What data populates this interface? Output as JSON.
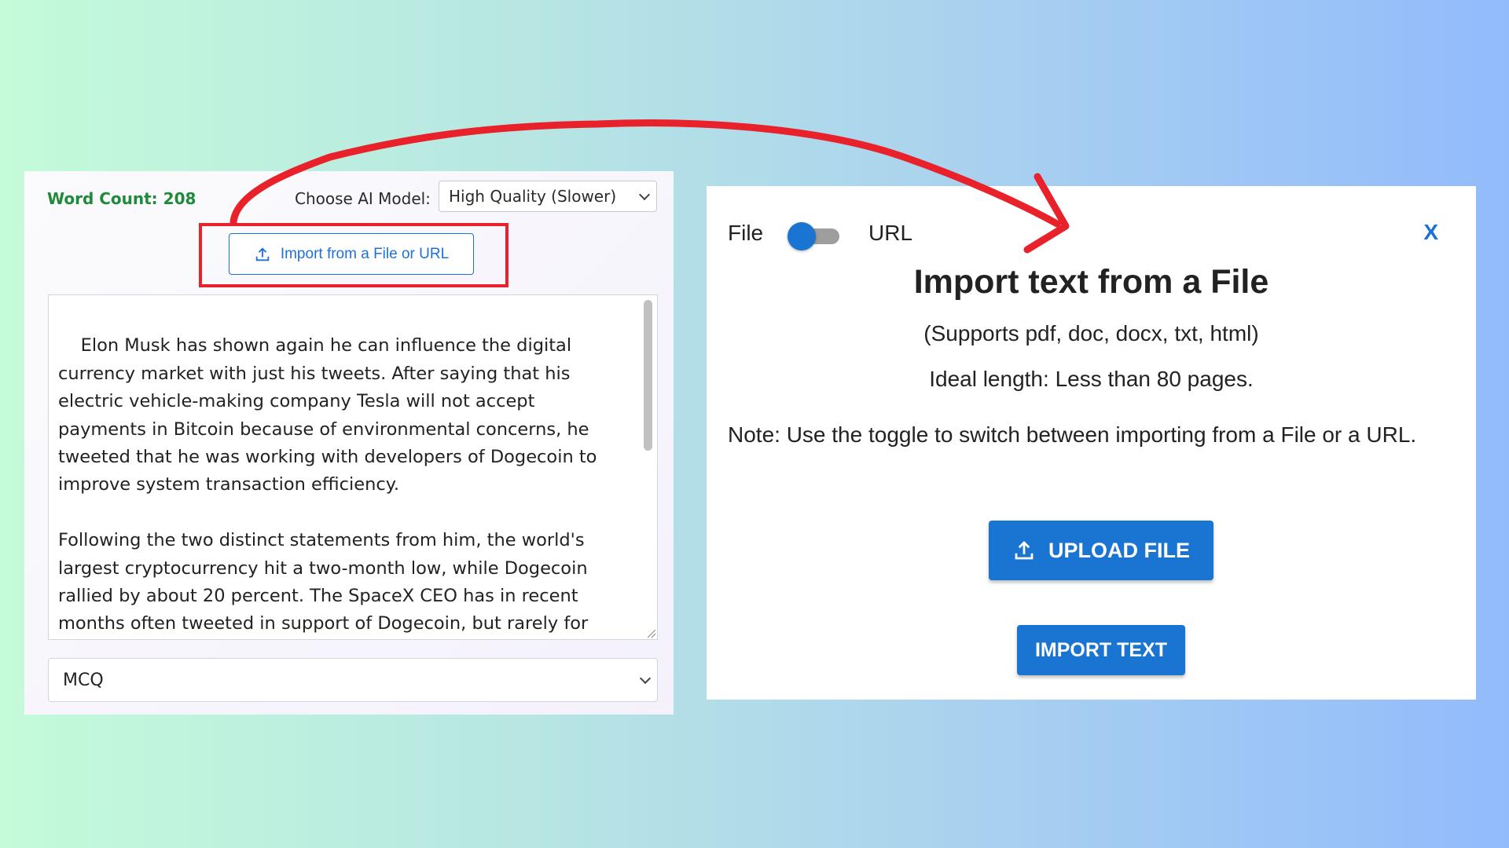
{
  "left": {
    "word_count": "Word Count: 208",
    "model_label": "Choose AI Model:",
    "model_value": "High Quality (Slower)",
    "import_button": "Import from a File or URL",
    "text_content": "Elon Musk has shown again he can influence the digital currency market with just his tweets. After saying that his electric vehicle-making company Tesla will not accept payments in Bitcoin because of environmental concerns, he tweeted that he was working with developers of Dogecoin to improve system transaction efficiency.\n\nFollowing the two distinct statements from him, the world's largest cryptocurrency hit a two-month low, while Dogecoin rallied by about 20 percent. The SpaceX CEO has in recent months often tweeted in support of Dogecoin, but rarely for Bitcoin.  In a recent tweet, Musk put out a statement from Tesla",
    "question_type": "MCQ"
  },
  "dialog": {
    "toggle_left": "File",
    "toggle_right": "URL",
    "close": "X",
    "title": "Import text from a File",
    "supports": "(Supports pdf, doc, docx, txt, html)",
    "ideal_length": "Ideal length: Less than 80 pages.",
    "note": "Note: Use the toggle to switch between importing from a File or a URL.",
    "upload_button": "UPLOAD FILE",
    "import_text_button": "IMPORT TEXT"
  },
  "colors": {
    "accent": "#1a74d2",
    "word_count": "#1f8a3a",
    "highlight": "#e8212b"
  },
  "icons": {
    "import": "upload-icon",
    "upload": "upload-icon",
    "arrow": "red-curved-arrow"
  }
}
